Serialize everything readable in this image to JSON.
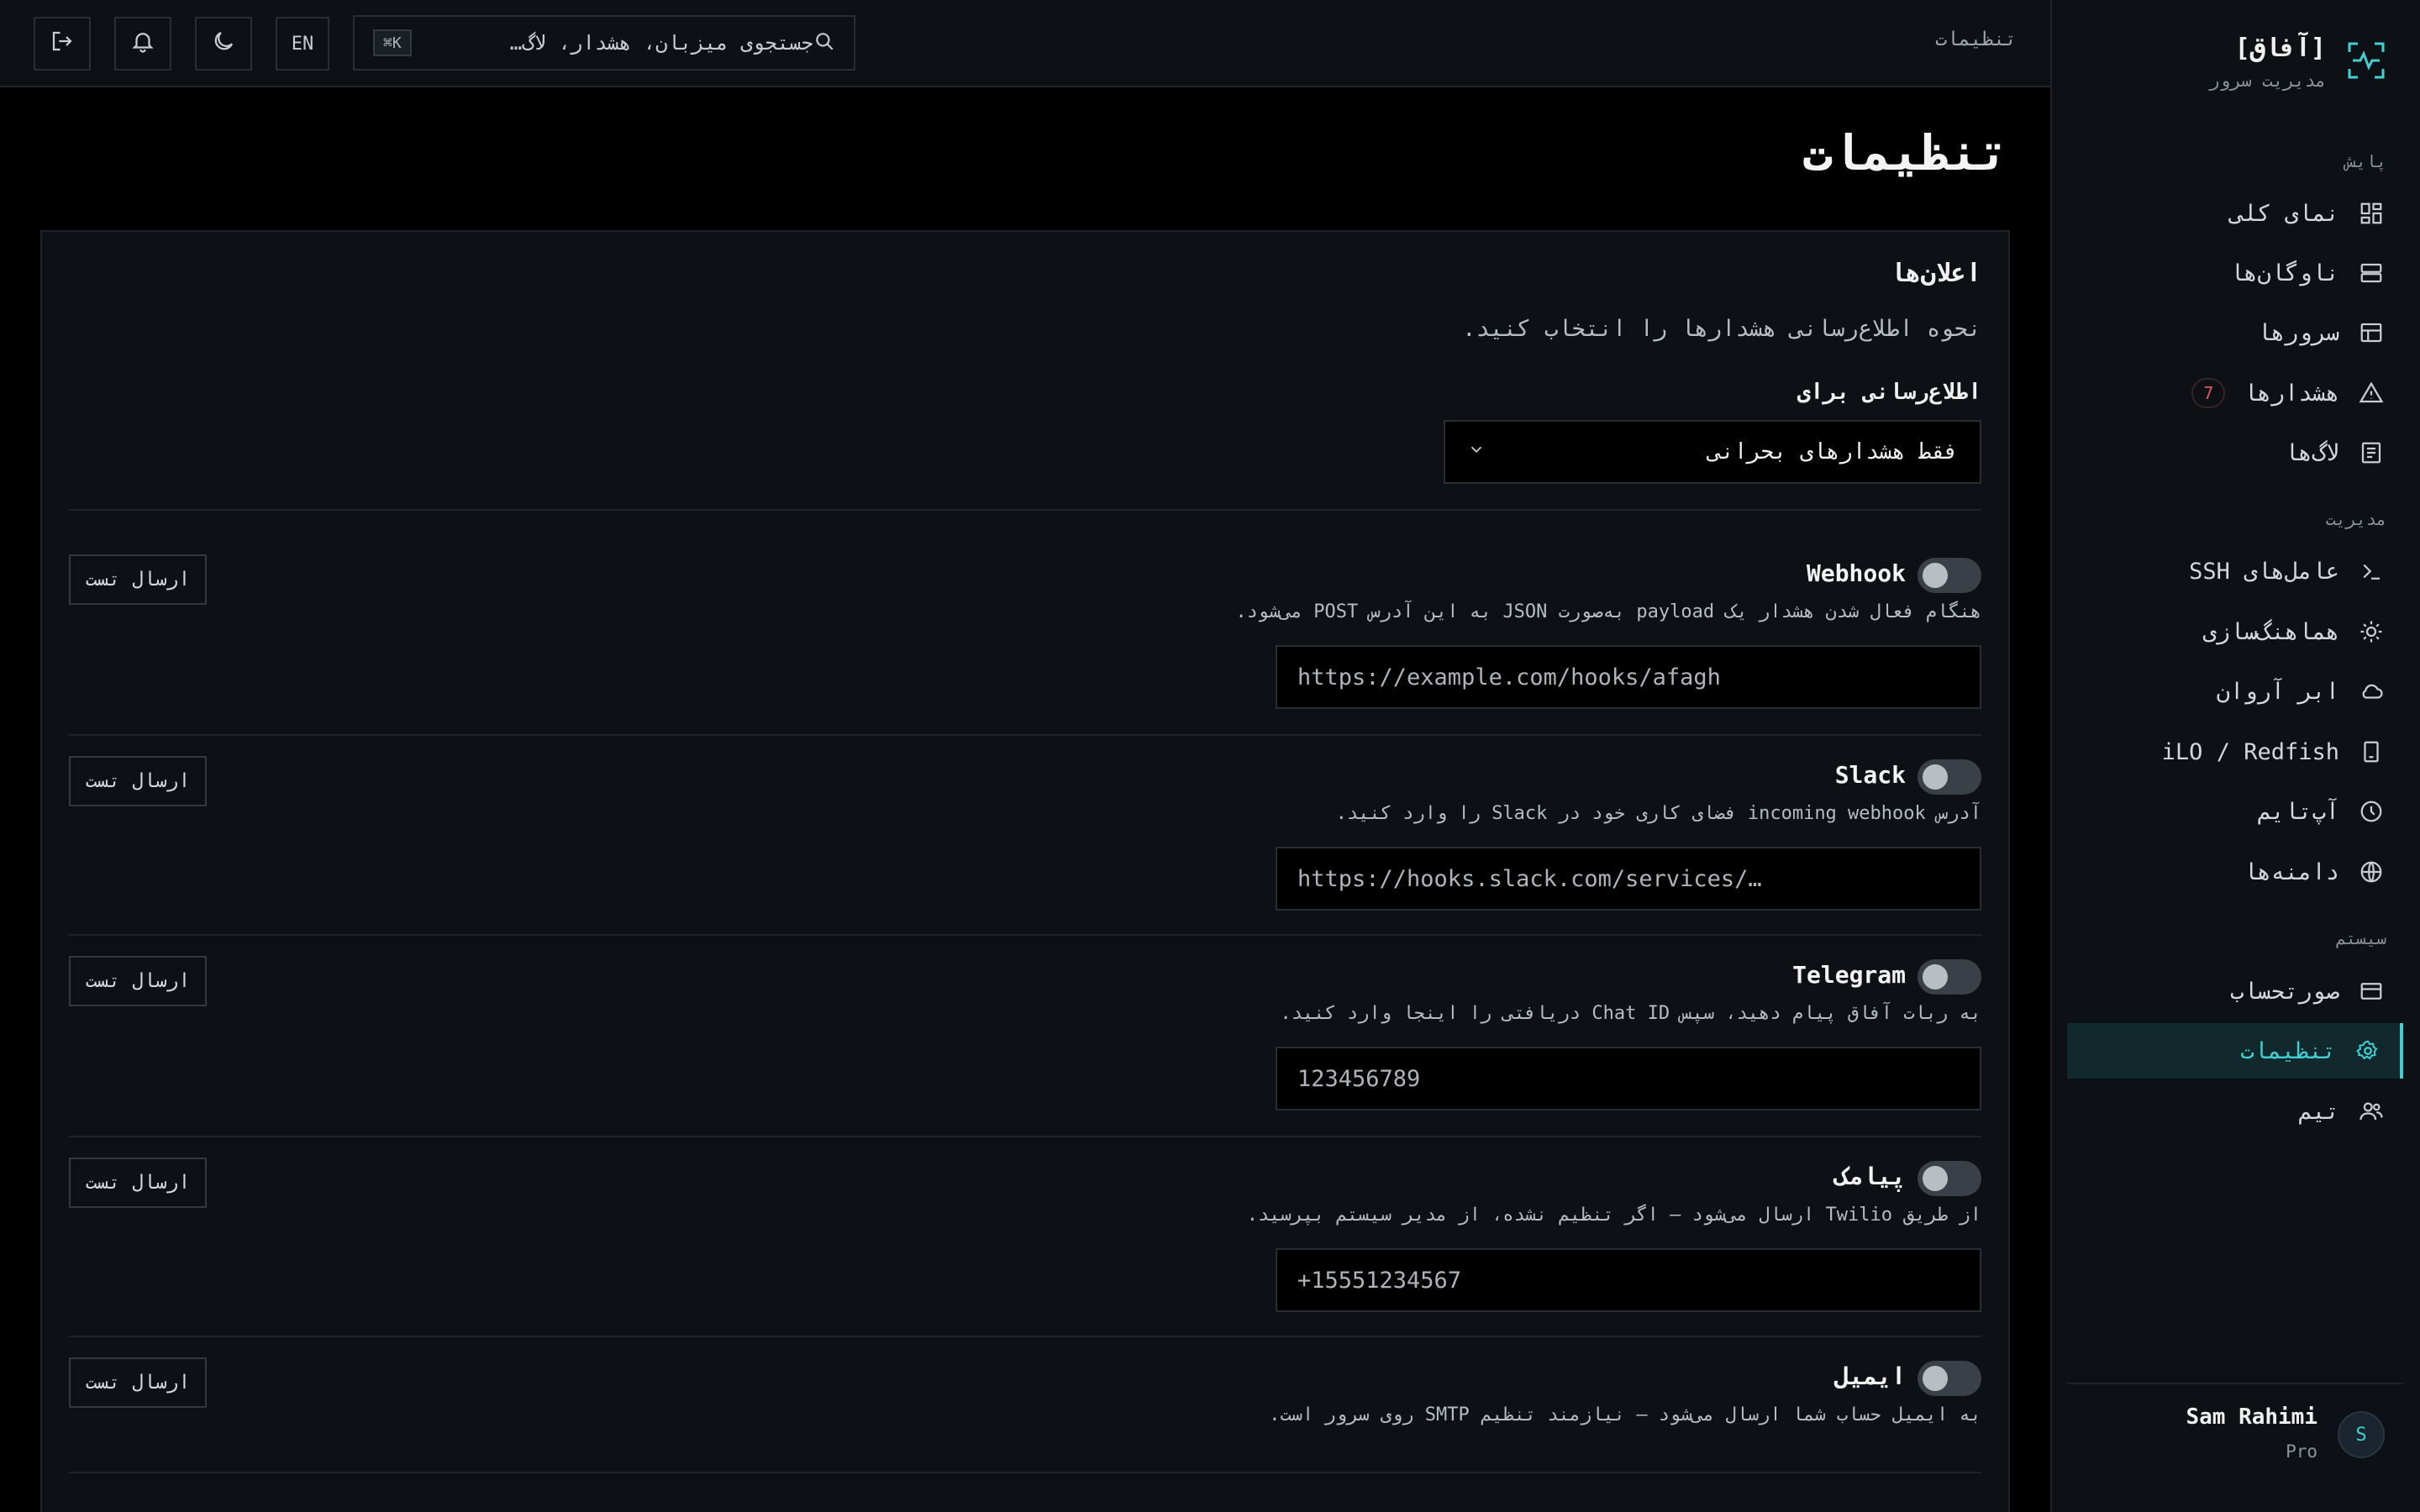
{
  "app": {
    "name": "[آفاق]",
    "subtitle": "مدیریت سرور"
  },
  "nav": {
    "sections": [
      {
        "title": "پایش"
      },
      {
        "title": "مدیریت"
      },
      {
        "title": "سیستم"
      }
    ],
    "items": [
      {
        "label": "نمای کلی",
        "icon": "grid-icon"
      },
      {
        "label": "ناوگان‌ها",
        "icon": "server-stack-icon"
      },
      {
        "label": "سرورها",
        "icon": "table-icon"
      },
      {
        "label": "هشدارها",
        "icon": "warning-icon",
        "badge": "7"
      },
      {
        "label": "لاگ‌ها",
        "icon": "document-icon"
      },
      {
        "label": "عامل‌های SSH",
        "icon": "terminal-icon"
      },
      {
        "label": "هماهنگ‌سازی",
        "icon": "sun-gear-icon"
      },
      {
        "label": "ابر آروان",
        "icon": "cloud-icon"
      },
      {
        "label": "iLO / Redfish",
        "icon": "device-icon"
      },
      {
        "label": "آپ‌تایم",
        "icon": "clock-icon"
      },
      {
        "label": "دامنه‌ها",
        "icon": "globe-icon"
      },
      {
        "label": "صورتحساب",
        "icon": "credit-card-icon"
      },
      {
        "label": "تنظیمات",
        "icon": "gear-icon",
        "active": true
      },
      {
        "label": "تیم",
        "icon": "users-icon"
      }
    ]
  },
  "user": {
    "initial": "S",
    "name": "Sam Rahimi",
    "plan": "Pro"
  },
  "topbar": {
    "breadcrumb": "تنظیمات",
    "search_placeholder": "جستجوی میزبان، هشدار، لاگ…",
    "shortcut": "K⌘",
    "lang": "EN"
  },
  "page": {
    "title": "تنظیمات"
  },
  "notifications": {
    "title": "اعلان‌ها",
    "description": "نحوه اطلاع‌رسانی هشدارها را انتخاب کنید.",
    "notify_label": "اطلاع‌رسانی برای",
    "notify_value": "فقط هشدارهای بحرانی",
    "test_label": "ارسال تست",
    "channels": [
      {
        "name": "Webhook",
        "description": "هنگام فعال شدن هشدار یک payload به‌صورت JSON به این آدرس POST می‌شود.",
        "placeholder": "https://example.com/hooks/afagh",
        "enabled": false
      },
      {
        "name": "Slack",
        "description": "آدرس incoming webhook فضای کاری خود در Slack را وارد کنید.",
        "placeholder": "https://hooks.slack.com/services/…",
        "enabled": false
      },
      {
        "name": "Telegram",
        "description": "به ربات آفاق پیام دهید، سپس Chat ID دریافتی را اینجا وارد کنید.",
        "placeholder": "123456789",
        "enabled": false
      },
      {
        "name": "پیامک",
        "description": "از طریق Twilio ارسال می‌شود — اگر تنظیم نشده، از مدیر سیستم بپرسید.",
        "placeholder": "+15551234567",
        "enabled": false
      },
      {
        "name": "ایمیل",
        "description": "به ایمیل حساب شما ارسال می‌شود — نیازمند تنظیم SMTP روی سرور است.",
        "enabled": false
      }
    ]
  },
  "colors": {
    "accent": "#3fd0d4",
    "background": "#000000",
    "panel": "#0d1014",
    "danger": "#e05a5a"
  }
}
